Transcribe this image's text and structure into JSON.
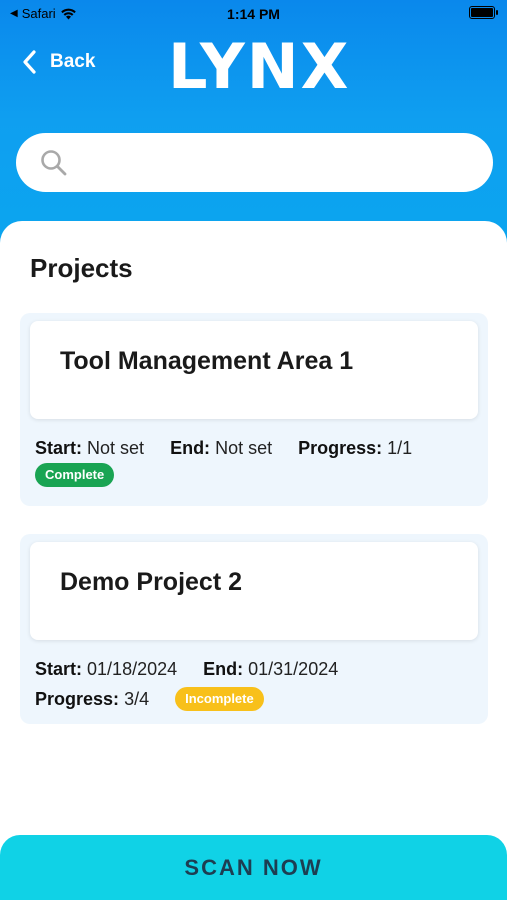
{
  "status_bar": {
    "carrier": "Safari",
    "time": "1:14 PM"
  },
  "header": {
    "back_label": "Back",
    "logo_text": "LYNX"
  },
  "search": {
    "placeholder": "",
    "value": ""
  },
  "projects": {
    "section_title": "Projects",
    "items": [
      {
        "title": "Tool Management Area 1",
        "start_label": "Start:",
        "start_value": "Not set",
        "end_label": "End:",
        "end_value": "Not set",
        "progress_label": "Progress:",
        "progress_value": "1/1",
        "status": "Complete",
        "status_color": "#19a453"
      },
      {
        "title": "Demo Project 2",
        "start_label": "Start:",
        "start_value": "01/18/2024",
        "end_label": "End:",
        "end_value": "01/31/2024",
        "progress_label": "Progress:",
        "progress_value": "3/4",
        "status": "Incomplete",
        "status_color": "#f8c01a"
      }
    ]
  },
  "footer": {
    "scan_label": "SCAN NOW"
  },
  "colors": {
    "header_blue": "#0a88ec",
    "scan_cyan": "#10d2e6",
    "card_bg": "#eef6fd"
  }
}
